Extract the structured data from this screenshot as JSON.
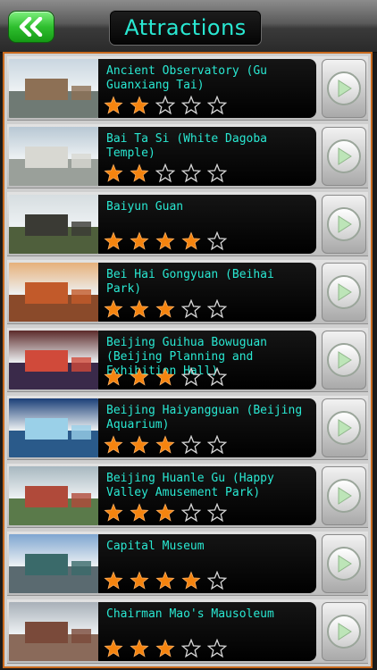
{
  "header": {
    "title": "Attractions",
    "back_icon": "double-chevron-left-icon"
  },
  "colors": {
    "accent_text": "#29e8d2",
    "star_filled": "#f5840f",
    "frame_border": "#c96a1e",
    "back_button": "#2fbf2f"
  },
  "attractions": [
    {
      "name": "Ancient Observatory (Gu Guanxiang Tai)",
      "rating": 2
    },
    {
      "name": "Bai Ta Si (White Dagoba Temple)",
      "rating": 2
    },
    {
      "name": "Baiyun Guan",
      "rating": 4
    },
    {
      "name": "Bei Hai Gongyuan (Beihai Park)",
      "rating": 3
    },
    {
      "name": "Beijing Guihua Bowuguan (Beijing Planning and Exhibition Hall)",
      "rating": 3
    },
    {
      "name": "Beijing Haiyangguan (Beijing Aquarium)",
      "rating": 3
    },
    {
      "name": "Beijing Huanle Gu (Happy Valley Amusement Park)",
      "rating": 3
    },
    {
      "name": "Capital Museum",
      "rating": 4
    },
    {
      "name": "Chairman Mao's Mausoleum",
      "rating": 3
    }
  ],
  "row_icons": {
    "go_icon": "play-arrow-icon",
    "star_icon": "star-icon"
  }
}
